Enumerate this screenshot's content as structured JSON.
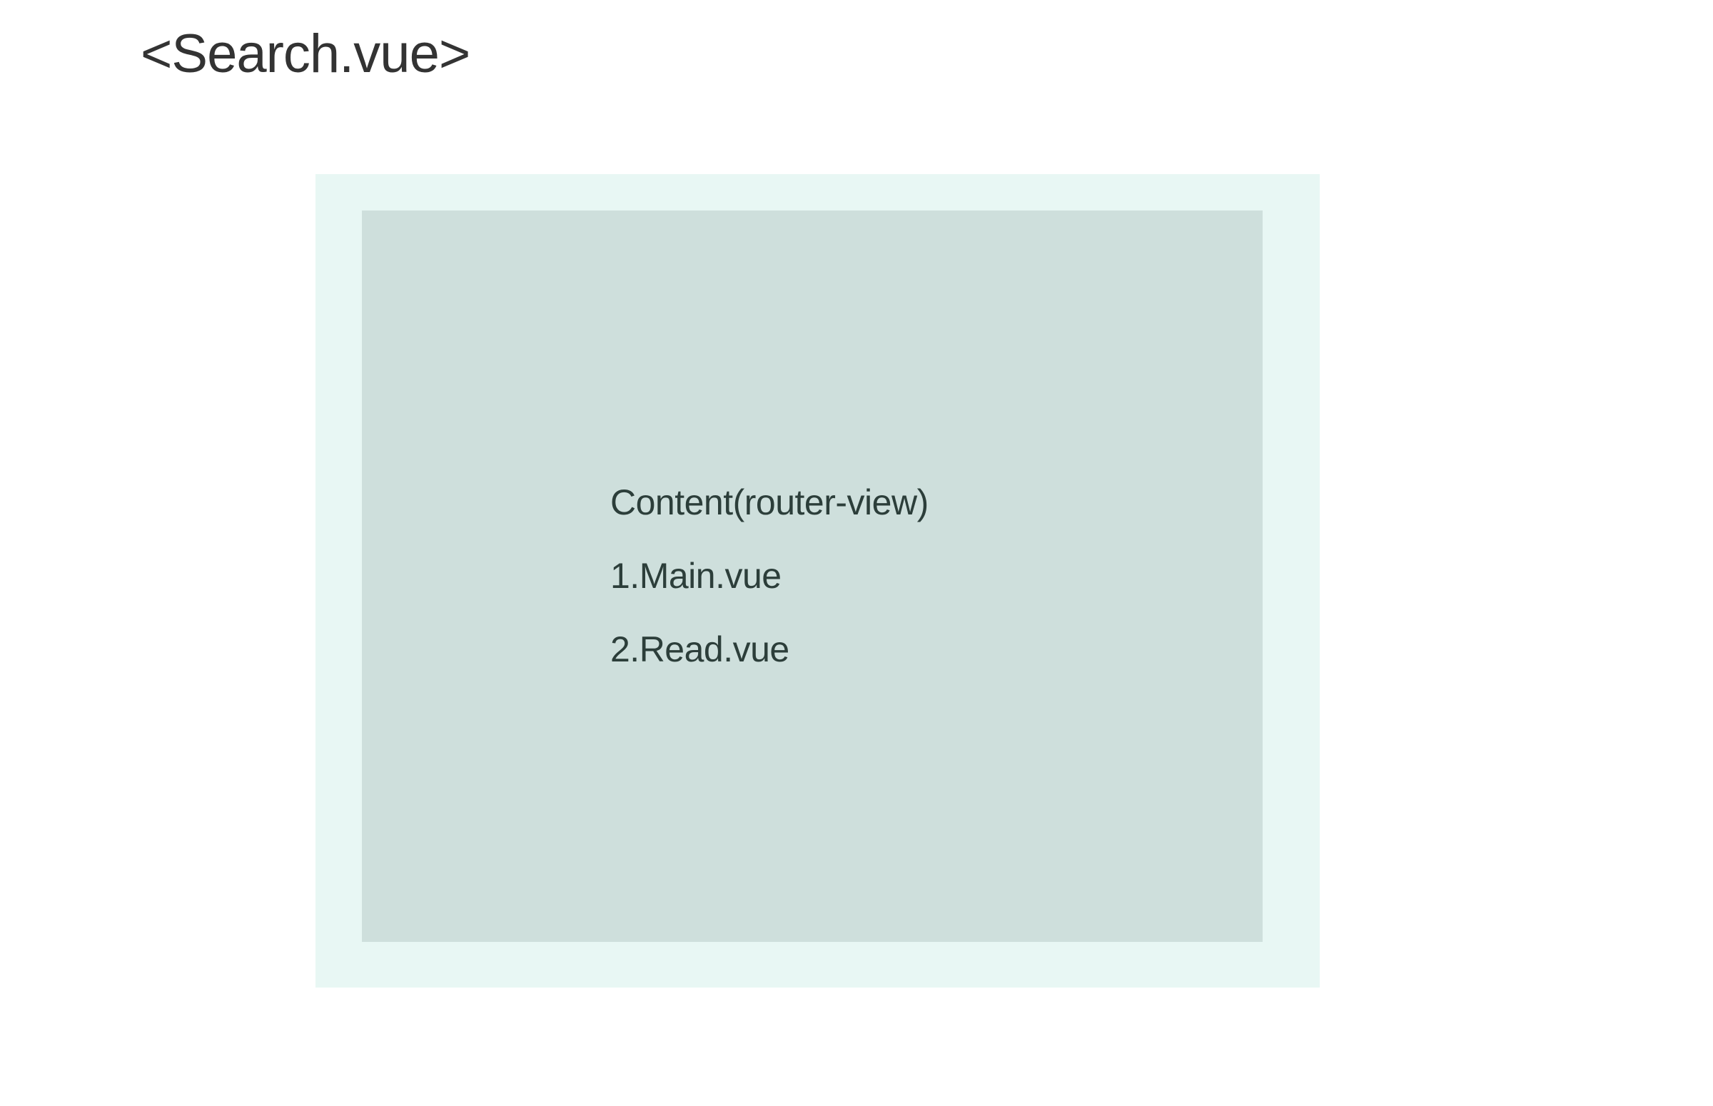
{
  "title": "<Search.vue>",
  "content": {
    "heading": "Content(router-view)",
    "items": [
      "1.Main.vue",
      "2.Read.vue"
    ]
  },
  "colors": {
    "outer_box": "#e8f7f4",
    "inner_box": "#cedfdc",
    "title_text": "#333333",
    "content_text": "#2c3e3a"
  }
}
